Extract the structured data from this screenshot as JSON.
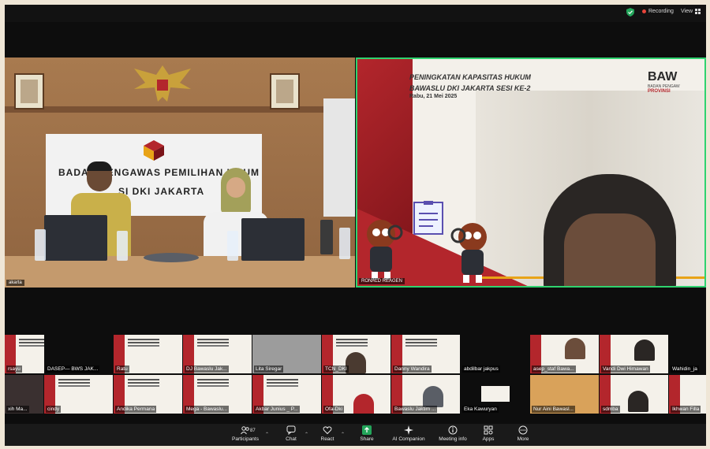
{
  "topbar": {
    "recording_label": "Recording",
    "view_label": "View",
    "accent_green": "#2fd36f",
    "record_red": "#e8443a"
  },
  "main_left": {
    "banner_line1": "BADAN PENGAWAS PEMILIHAN UMUM",
    "banner_line2": "SI DKI JAKARTA",
    "name_label": "akarta"
  },
  "main_right": {
    "slide_title_line1": "PENINGKATAN KAPASITAS HUKUM",
    "slide_title_line2": "BAWASLU DKI JAKARTA SESI KE-2",
    "slide_date": "Rabu, 21 Mei 2025",
    "logo_text": "BAW",
    "logo_sub": "BADAN PENGAW",
    "logo_sub2": "PROVINSI",
    "name_label": "RONALD REAGEN"
  },
  "thumbnails": [
    {
      "label": "rsayu"
    },
    {
      "label": "DASEP— BWS JAK..."
    },
    {
      "label": "Ratu"
    },
    {
      "label": "DJ Bawaslu Jak..."
    },
    {
      "label": "Lita Siregar"
    },
    {
      "label": "TCN_DKI"
    },
    {
      "label": "Danny Wandira"
    },
    {
      "label": "abdilbar jakpus"
    },
    {
      "label": "asep_staf Bawa..."
    },
    {
      "label": "Vandi Dwi Himawan"
    },
    {
      "label": "Wahidin_ja"
    },
    {
      "label": "xih Ma..."
    },
    {
      "label": "cindy"
    },
    {
      "label": "Andika Permana"
    },
    {
      "label": "Mega - Bawaslu..."
    },
    {
      "label": "Akbar Junius _ P..."
    },
    {
      "label": "Ofa-Dki"
    },
    {
      "label": "Bawaslu Jaktim ..."
    },
    {
      "label": "Eka Kawuryan"
    },
    {
      "label": "Nur Aini Bawasl..."
    },
    {
      "label": "sdmba"
    },
    {
      "label": "Ikhwan Filla"
    }
  ],
  "toolbar": {
    "participants_label": "Participants",
    "participants_count": "87",
    "chat_label": "Chat",
    "react_label": "React",
    "share_label": "Share",
    "ai_label": "AI Companion",
    "meeting_label": "Meeting info",
    "apps_label": "Apps",
    "more_label": "More"
  }
}
